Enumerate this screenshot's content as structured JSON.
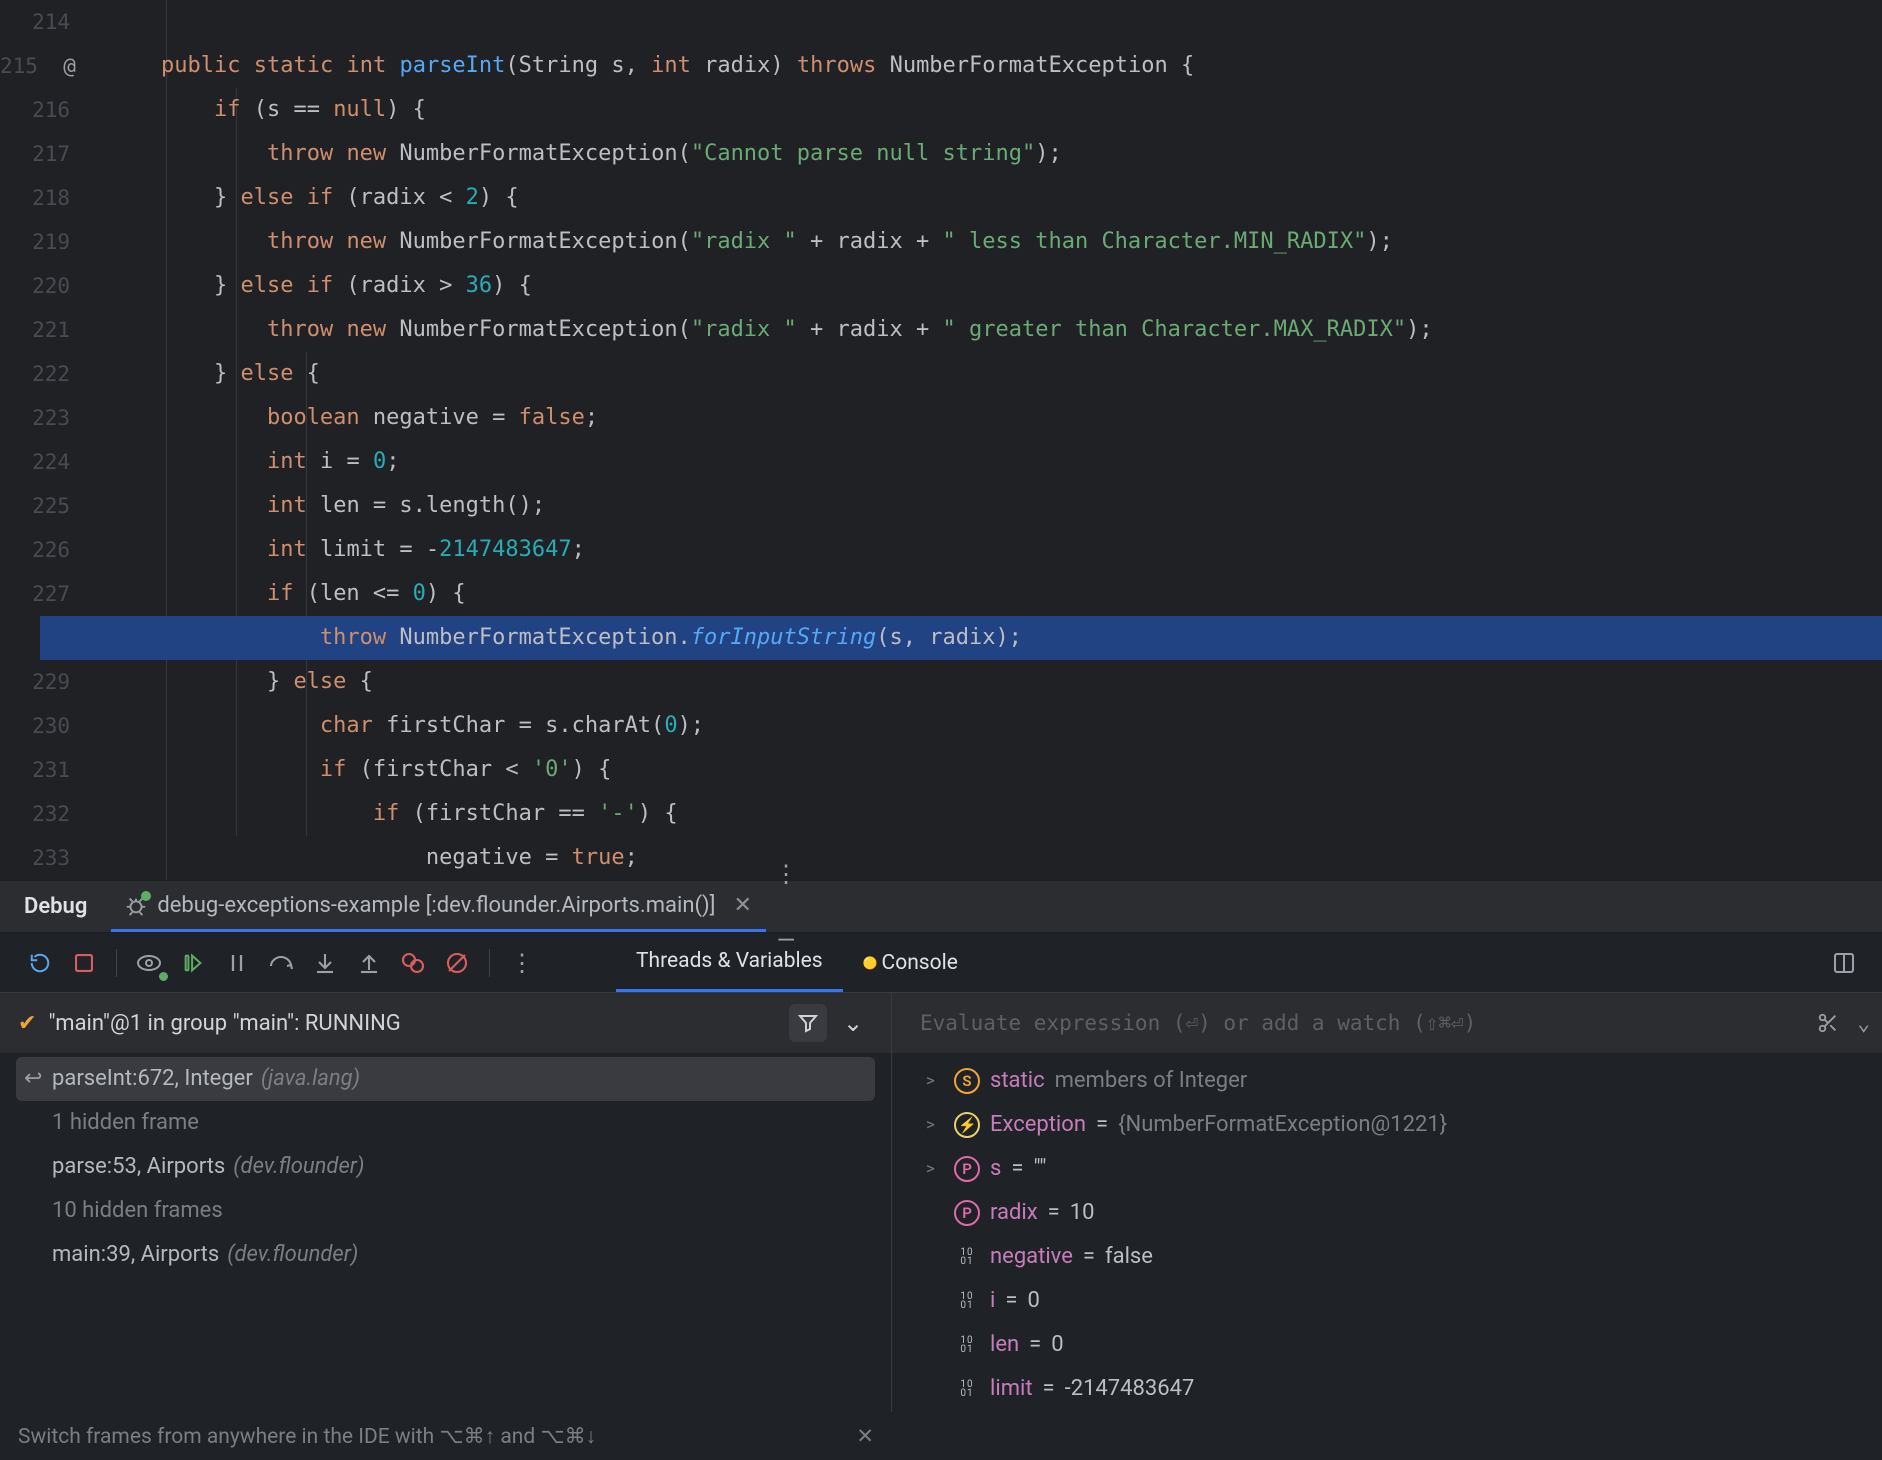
{
  "code": {
    "lines": [
      {
        "n": "214",
        "html": ""
      },
      {
        "n": "215",
        "html": "    <span class='kw'>public</span> <span class='kw'>static</span> <span class='ty'>int</span> <span class='fn'>parseInt</span>(String s, <span class='ty'>int</span> radix) <span class='kw'>throws</span> NumberFormatException {",
        "mark": "@"
      },
      {
        "n": "216",
        "html": "        <span class='kw'>if</span> (s == <span class='kw'>null</span>) {"
      },
      {
        "n": "217",
        "html": "            <span class='kw'>throw</span> <span class='kw'>new</span> NumberFormatException(<span class='str'>\"Cannot parse null string\"</span>);"
      },
      {
        "n": "218",
        "html": "        } <span class='kw'>else</span> <span class='kw'>if</span> (radix &lt; <span class='num'>2</span>) {"
      },
      {
        "n": "219",
        "html": "            <span class='kw'>throw</span> <span class='kw'>new</span> NumberFormatException(<span class='str'>\"radix \"</span> + radix + <span class='str'>\" less than Character.MIN_RADIX\"</span>);"
      },
      {
        "n": "220",
        "html": "        } <span class='kw'>else</span> <span class='kw'>if</span> (radix &gt; <span class='num'>36</span>) {"
      },
      {
        "n": "221",
        "html": "            <span class='kw'>throw</span> <span class='kw'>new</span> NumberFormatException(<span class='str'>\"radix \"</span> + radix + <span class='str'>\" greater than Character.MAX_RADIX\"</span>);"
      },
      {
        "n": "222",
        "html": "        } <span class='kw'>else</span> {"
      },
      {
        "n": "223",
        "html": "            <span class='ty'>boolean</span> negative = <span class='kw'>false</span>;"
      },
      {
        "n": "224",
        "html": "            <span class='ty'>int</span> i = <span class='num'>0</span>;"
      },
      {
        "n": "225",
        "html": "            <span class='ty'>int</span> len = s.length();"
      },
      {
        "n": "226",
        "html": "            <span class='ty'>int</span> limit = -<span class='num'>2147483647</span>;"
      },
      {
        "n": "227",
        "html": "            <span class='kw'>if</span> (len &lt;= <span class='num'>0</span>) {"
      },
      {
        "n": "",
        "html": "                <span class='kw'>throw</span> NumberFormatException.<span class='it'>forInputString</span>(s, radix);",
        "hl": true,
        "bolt": true
      },
      {
        "n": "229",
        "html": "            } <span class='kw'>else</span> {"
      },
      {
        "n": "230",
        "html": "                <span class='ty'>char</span> firstChar = s.charAt(<span class='num'>0</span>);"
      },
      {
        "n": "231",
        "html": "                <span class='kw'>if</span> (firstChar &lt; <span class='str'>'0'</span>) {"
      },
      {
        "n": "232",
        "html": "                    <span class='kw'>if</span> (firstChar == <span class='str'>'-'</span>) {"
      },
      {
        "n": "233",
        "html": "                        negative = <span class='kw'>true</span>;"
      }
    ]
  },
  "toolwindow": {
    "title": "Debug",
    "tab_label": "debug-exceptions-example [:dev.flounder.Airports.main()]"
  },
  "debug_tabs": {
    "threads": "Threads & Variables",
    "console": "Console"
  },
  "thread_status": "\"main\"@1 in group \"main\": RUNNING",
  "frames": [
    {
      "sel": true,
      "icon": "undo",
      "main": "parseInt:672, Integer ",
      "fade": "(java.lang)"
    },
    {
      "mut": "1 hidden frame"
    },
    {
      "main": "parse:53, Airports ",
      "fade": "(dev.flounder)"
    },
    {
      "mut": "10 hidden frames"
    },
    {
      "main": "main:39, Airports ",
      "fade": "(dev.flounder)"
    }
  ],
  "watch_placeholder": "Evaluate expression (⏎) or add a watch (⇧⌘⏎)",
  "vars": [
    {
      "chev": ">",
      "badge": "S",
      "bcol": "b-or",
      "name": "static",
      "after": "members of Integer",
      "dim": true
    },
    {
      "chev": ">",
      "badge": "⚡",
      "bcol": "b-yl",
      "name": "Exception",
      "eq": " = ",
      "val": "{NumberFormatException@1221}",
      "valdim": true
    },
    {
      "chev": ">",
      "badge": "P",
      "bcol": "b-pk",
      "name": "s",
      "eq": " = ",
      "val": "\"\""
    },
    {
      "badge": "P",
      "bcol": "b-pk",
      "name": "radix",
      "eq": " = ",
      "val": "10"
    },
    {
      "b10": true,
      "name": "negative",
      "eq": " = ",
      "val": "false"
    },
    {
      "b10": true,
      "name": "i",
      "eq": " = ",
      "val": "0"
    },
    {
      "b10": true,
      "name": "len",
      "eq": " = ",
      "val": "0"
    },
    {
      "b10": true,
      "name": "limit",
      "eq": " = ",
      "val": "-2147483647"
    }
  ],
  "tip": "Switch frames from anywhere in the IDE with ⌥⌘↑ and ⌥⌘↓"
}
